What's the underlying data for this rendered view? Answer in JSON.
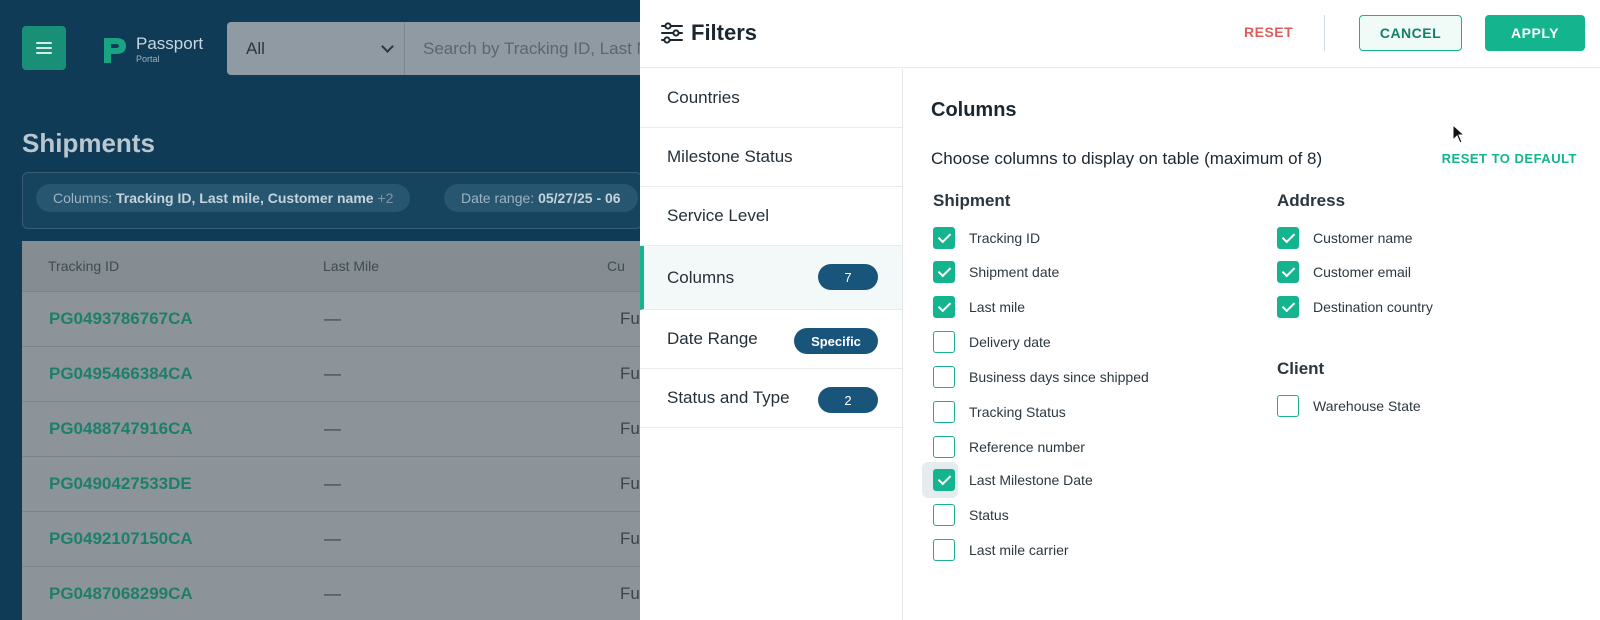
{
  "app": {
    "logo_name": "Passport",
    "logo_sub": "Portal",
    "search_select": "All",
    "search_placeholder": "Search by Tracking ID, Last M",
    "page_title": "Shipments",
    "chips": [
      {
        "label": "Columns:",
        "value": "Tracking ID, Last mile, Customer name",
        "extra": "+2"
      },
      {
        "label": "Date range:",
        "value": "05/27/25 - 06"
      }
    ],
    "table": {
      "headers": [
        "Tracking ID",
        "Last Mile",
        "Cu"
      ],
      "rows": [
        {
          "tracking_id": "PG0493786767CA",
          "last_mile": "—",
          "customer": "Ful"
        },
        {
          "tracking_id": "PG0495466384CA",
          "last_mile": "—",
          "customer": "Ful"
        },
        {
          "tracking_id": "PG0488747916CA",
          "last_mile": "—",
          "customer": "Ful"
        },
        {
          "tracking_id": "PG0490427533DE",
          "last_mile": "—",
          "customer": "Ful"
        },
        {
          "tracking_id": "PG0492107150CA",
          "last_mile": "—",
          "customer": "Ful"
        },
        {
          "tracking_id": "PG0487068299CA",
          "last_mile": "—",
          "customer": "Ful"
        }
      ]
    }
  },
  "filters": {
    "title": "Filters",
    "reset_label": "RESET",
    "cancel_label": "CANCEL",
    "apply_label": "APPLY",
    "nav": [
      {
        "label": "Countries",
        "badge": ""
      },
      {
        "label": "Milestone Status",
        "badge": ""
      },
      {
        "label": "Service Level",
        "badge": ""
      },
      {
        "label": "Columns",
        "badge": "7",
        "active": true
      },
      {
        "label": "Date Range",
        "badge": "Specific"
      },
      {
        "label": "Status and Type",
        "badge": "2"
      }
    ],
    "columns": {
      "title": "Columns",
      "subtitle": "Choose columns to display on table (maximum of 8)",
      "reset_default": "RESET TO DEFAULT",
      "shipment": {
        "title": "Shipment",
        "items": [
          {
            "label": "Tracking ID",
            "checked": true
          },
          {
            "label": "Shipment date",
            "checked": true
          },
          {
            "label": "Last mile",
            "checked": true
          },
          {
            "label": "Delivery date",
            "checked": false
          },
          {
            "label": "Business days since shipped",
            "checked": false
          },
          {
            "label": "Tracking Status",
            "checked": false
          },
          {
            "label": "Reference number",
            "checked": false
          },
          {
            "label": "Last Milestone Date",
            "checked": true
          },
          {
            "label": "Status",
            "checked": false
          },
          {
            "label": "Last mile carrier",
            "checked": false
          }
        ]
      },
      "address": {
        "title": "Address",
        "items": [
          {
            "label": "Customer name",
            "checked": true
          },
          {
            "label": "Customer email",
            "checked": true
          },
          {
            "label": "Destination country",
            "checked": true
          }
        ]
      },
      "client": {
        "title": "Client",
        "items": [
          {
            "label": "Warehouse State",
            "checked": false
          }
        ]
      }
    }
  },
  "colors": {
    "accent": "#14b48e",
    "badge": "#19557a",
    "reset": "#e25b5b",
    "backdrop": "#0f3b57"
  }
}
